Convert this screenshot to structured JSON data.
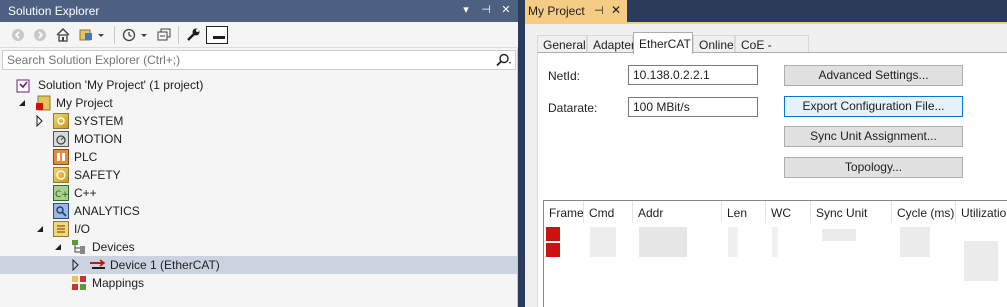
{
  "solution_explorer": {
    "title": "Solution Explorer",
    "title_buttons": [
      "▾",
      "⊣",
      "✕"
    ],
    "search": {
      "placeholder": "Search Solution Explorer (Ctrl+;)",
      "value": ""
    },
    "tree": [
      {
        "label": "Solution 'My Project' (1 project)",
        "icon": "solution-icon"
      },
      {
        "label": "My Project",
        "icon": "project-icon"
      },
      {
        "label": "SYSTEM",
        "icon": "system-icon"
      },
      {
        "label": "MOTION",
        "icon": "motion-icon"
      },
      {
        "label": "PLC",
        "icon": "plc-icon"
      },
      {
        "label": "SAFETY",
        "icon": "safety-icon"
      },
      {
        "label": "C++",
        "icon": "cpp-icon"
      },
      {
        "label": "ANALYTICS",
        "icon": "analytics-icon"
      },
      {
        "label": "I/O",
        "icon": "io-icon"
      },
      {
        "label": "Devices",
        "icon": "devices-icon"
      },
      {
        "label": "Device 1 (EtherCAT)",
        "icon": "ethercat-device-icon"
      },
      {
        "label": "Mappings",
        "icon": "mappings-icon"
      }
    ]
  },
  "document": {
    "tab_title": "My Project",
    "pin_glyph": "⊣",
    "close_glyph": "✕",
    "inner_tabs": [
      "General",
      "Adapter",
      "EtherCAT",
      "Online",
      "CoE - Online"
    ],
    "active_inner_tab": "EtherCAT",
    "fields": {
      "netid_label": "NetId:",
      "netid_value": "10.138.0.2.2.1",
      "datarate_label": "Datarate:",
      "datarate_value": "100 MBit/s"
    },
    "buttons": {
      "advanced": "Advanced Settings...",
      "export": "Export Configuration File...",
      "sync_unit": "Sync Unit Assignment...",
      "topology": "Topology..."
    },
    "grid": {
      "columns": [
        "Frame",
        "Cmd",
        "Addr",
        "Len",
        "WC",
        "Sync Unit",
        "Cycle (ms)",
        "Utilization"
      ]
    }
  },
  "colors": {
    "title_bar": "#4d6082",
    "doc_tab": "#f5cc84",
    "selected_row": "#ccd3e0",
    "frame_marker": "#cc1111",
    "focus_button_border": "#0078d7"
  }
}
